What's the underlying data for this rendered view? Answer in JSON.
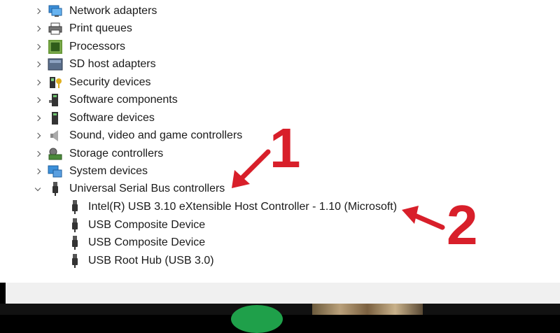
{
  "tree": {
    "categories": [
      {
        "label": "Network adapters",
        "icon": "network-adapter-icon",
        "expanded": false
      },
      {
        "label": "Print queues",
        "icon": "printer-icon",
        "expanded": false
      },
      {
        "label": "Processors",
        "icon": "processor-icon",
        "expanded": false
      },
      {
        "label": "SD host adapters",
        "icon": "sd-card-icon",
        "expanded": false
      },
      {
        "label": "Security devices",
        "icon": "security-key-icon",
        "expanded": false
      },
      {
        "label": "Software components",
        "icon": "software-component-icon",
        "expanded": false
      },
      {
        "label": "Software devices",
        "icon": "software-device-icon",
        "expanded": false
      },
      {
        "label": "Sound, video and game controllers",
        "icon": "speaker-icon",
        "expanded": false
      },
      {
        "label": "Storage controllers",
        "icon": "storage-controller-icon",
        "expanded": false
      },
      {
        "label": "System devices",
        "icon": "system-devices-icon",
        "expanded": false
      },
      {
        "label": "Universal Serial Bus controllers",
        "icon": "usb-icon",
        "expanded": true
      }
    ],
    "usb_children": [
      {
        "label": "Intel(R) USB 3.10 eXtensible Host Controller - 1.10 (Microsoft)",
        "icon": "usb-plug-icon"
      },
      {
        "label": "USB Composite Device",
        "icon": "usb-plug-icon"
      },
      {
        "label": "USB Composite Device",
        "icon": "usb-plug-icon"
      },
      {
        "label": "USB Root Hub (USB 3.0)",
        "icon": "usb-plug-icon"
      }
    ]
  },
  "annotations": {
    "marker1": "1",
    "marker2": "2",
    "color": "#d81f2a"
  }
}
